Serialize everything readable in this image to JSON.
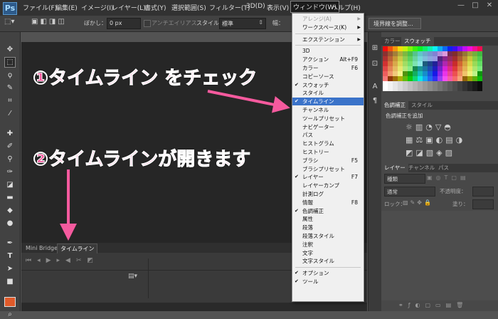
{
  "app": {
    "logo": "Ps"
  },
  "menubar": {
    "items": [
      "ファイル(F)",
      "編集(E)",
      "イメージ(I)",
      "レイヤー(L)",
      "書式(Y)",
      "選択範囲(S)",
      "フィルター(T)",
      "3D(D)",
      "表示(V)",
      "ウィンドウ(W)",
      "ヘルプ(H)"
    ],
    "window_controls": [
      "—",
      "□",
      "✕"
    ]
  },
  "options": {
    "blur_label": "ぼかし：",
    "blur_value": "0 px",
    "antialias_label": "アンチエイリアス",
    "style_label": "スタイル：",
    "style_value": "標準",
    "width_label": "幅：",
    "refine_edge_button": "境界線を調整..."
  },
  "annotations": {
    "step1": "①タイムライン をチェック",
    "step2": "②タイムラインが開きます",
    "accent_color": "#f55a9e"
  },
  "window_menu": {
    "items": [
      {
        "label": "アレンジ(A)",
        "disabled": true,
        "submenu": true
      },
      {
        "label": "ワークスペース(K)",
        "submenu": true
      },
      {
        "separator": true
      },
      {
        "label": "エクステンション",
        "submenu": true
      },
      {
        "separator": true
      },
      {
        "label": "3D"
      },
      {
        "label": "アクション",
        "shortcut": "Alt+F9"
      },
      {
        "label": "カラー",
        "shortcut": "F6"
      },
      {
        "label": "コピーソース"
      },
      {
        "label": "スウォッチ",
        "checked": true
      },
      {
        "label": "スタイル"
      },
      {
        "label": "タイムライン",
        "checked": true,
        "highlighted": true
      },
      {
        "label": "チャンネル"
      },
      {
        "label": "ツールプリセット"
      },
      {
        "label": "ナビゲーター"
      },
      {
        "label": "パス"
      },
      {
        "label": "ヒストグラム"
      },
      {
        "label": "ヒストリー"
      },
      {
        "label": "ブラシ",
        "shortcut": "F5"
      },
      {
        "label": "ブラシプリセット"
      },
      {
        "label": "レイヤー",
        "checked": true,
        "shortcut": "F7"
      },
      {
        "label": "レイヤーカンプ"
      },
      {
        "label": "計測ログ"
      },
      {
        "label": "情報",
        "shortcut": "F8"
      },
      {
        "label": "色調補正",
        "checked": true
      },
      {
        "label": "属性"
      },
      {
        "label": "段落"
      },
      {
        "label": "段落スタイル"
      },
      {
        "label": "注釈"
      },
      {
        "label": "文字"
      },
      {
        "label": "文字スタイル"
      },
      {
        "separator": true
      },
      {
        "label": "オプション",
        "checked": true
      },
      {
        "label": "ツール",
        "checked": true
      }
    ]
  },
  "bottom_panel": {
    "tabs": [
      "Mini Bridge",
      "タイムライン"
    ],
    "active_tab": "タイムライン"
  },
  "right_panels": {
    "color_tabs": [
      "カラー",
      "スウォッチ"
    ],
    "adjust_tabs": [
      "色調補正",
      "スタイル"
    ],
    "adjust_title": "色調補正を追加",
    "layer_tabs": [
      "レイヤー",
      "チャンネル",
      "パス"
    ],
    "kind_value": "種類",
    "blend_mode": "通常",
    "opacity_label": "不透明度：",
    "lock_label": "ロック：",
    "fill_label": "塗り："
  }
}
